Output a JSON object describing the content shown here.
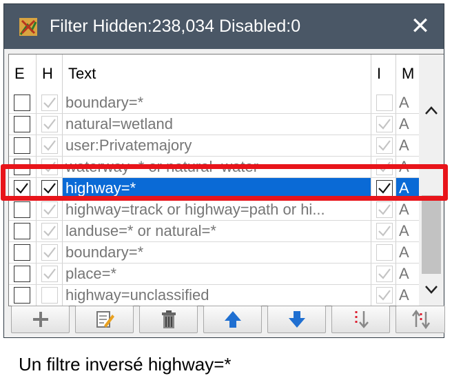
{
  "window": {
    "title": "Filter Hidden:238,034 Disabled:0",
    "close_label": "✕"
  },
  "table": {
    "columns": [
      {
        "label": "E"
      },
      {
        "label": "H"
      },
      {
        "label": "Text"
      },
      {
        "label": "I"
      },
      {
        "label": "M"
      }
    ],
    "rows": [
      {
        "enabled": false,
        "hidden": true,
        "text": "boundary=*",
        "inverted": false,
        "mode": "A",
        "selected": false
      },
      {
        "enabled": false,
        "hidden": true,
        "text": "natural=wetland",
        "inverted": true,
        "mode": "A",
        "selected": false
      },
      {
        "enabled": false,
        "hidden": true,
        "text": "user:Privatemajory",
        "inverted": true,
        "mode": "A",
        "selected": false
      },
      {
        "enabled": false,
        "hidden": true,
        "text": "waterway=* or natural=water",
        "inverted": true,
        "mode": "A",
        "selected": false
      },
      {
        "enabled": true,
        "hidden": true,
        "text": "highway=*",
        "inverted": true,
        "mode": "A",
        "selected": true
      },
      {
        "enabled": false,
        "hidden": true,
        "text": "highway=track or highway=path or hi...",
        "inverted": true,
        "mode": "A",
        "selected": false
      },
      {
        "enabled": false,
        "hidden": true,
        "text": "landuse=* or natural=*",
        "inverted": true,
        "mode": "A",
        "selected": false
      },
      {
        "enabled": false,
        "hidden": true,
        "text": "boundary=*",
        "inverted": false,
        "mode": "A",
        "selected": false
      },
      {
        "enabled": false,
        "hidden": true,
        "text": "place=*",
        "inverted": true,
        "mode": "A",
        "selected": false
      },
      {
        "enabled": false,
        "hidden": false,
        "text": "highway=unclassified",
        "inverted": true,
        "mode": "A",
        "selected": false
      }
    ]
  },
  "scrollbar": {
    "up_label": "^",
    "down_label": "v"
  },
  "toolbar": {
    "buttons": [
      {
        "icon": "plus-icon"
      },
      {
        "icon": "edit-icon"
      },
      {
        "icon": "trash-icon"
      },
      {
        "icon": "arrow-up-icon"
      },
      {
        "icon": "arrow-down-icon"
      },
      {
        "icon": "sort-down-icon"
      },
      {
        "icon": "sort-order-icon"
      }
    ]
  },
  "caption": "Un filtre inversé highway=*",
  "colors": {
    "titlebar": "#4a5766",
    "selection": "#0a6ad6",
    "highlight": "#e8141a"
  }
}
